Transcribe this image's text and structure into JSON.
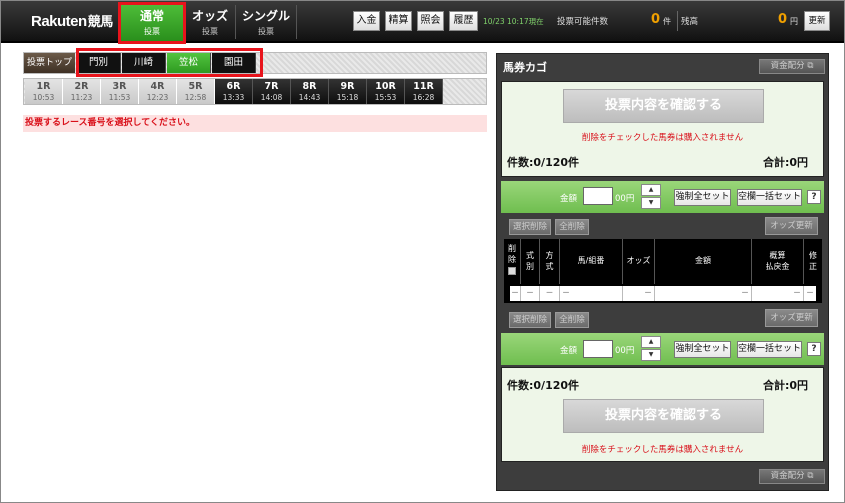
{
  "header": {
    "logo": "Rakuten",
    "logo_sub": "競馬",
    "tabs": [
      {
        "title": "通常",
        "sub": "投票",
        "active": true
      },
      {
        "title": "オッズ",
        "sub": "投票",
        "active": false
      },
      {
        "title": "シングル",
        "sub": "投票",
        "active": false
      }
    ],
    "buttons": {
      "deposit": "入金",
      "settle": "精算",
      "inquiry": "照会",
      "history": "履歴",
      "refresh": "更新"
    },
    "as_of": "10/23 10:17現在",
    "votable_label": "投票可能件数",
    "votable_value": "0",
    "votable_unit": "件",
    "balance_label": "残高",
    "balance_value": "0",
    "balance_unit": "円"
  },
  "tracks": {
    "top_label": "投票トップ",
    "items": [
      {
        "name": "門別",
        "active": false
      },
      {
        "name": "川崎",
        "active": false
      },
      {
        "name": "笠松",
        "active": true
      },
      {
        "name": "園田",
        "active": false
      }
    ]
  },
  "races": [
    {
      "num": "1R",
      "time": "10:53",
      "open": false
    },
    {
      "num": "2R",
      "time": "11:23",
      "open": false
    },
    {
      "num": "3R",
      "time": "11:53",
      "open": false
    },
    {
      "num": "4R",
      "time": "12:23",
      "open": false
    },
    {
      "num": "5R",
      "time": "12:58",
      "open": false
    },
    {
      "num": "6R",
      "time": "13:33",
      "open": true
    },
    {
      "num": "7R",
      "time": "14:08",
      "open": true
    },
    {
      "num": "8R",
      "time": "14:43",
      "open": true
    },
    {
      "num": "9R",
      "time": "15:18",
      "open": true
    },
    {
      "num": "10R",
      "time": "15:53",
      "open": true
    },
    {
      "num": "11R",
      "time": "16:28",
      "open": true
    }
  ],
  "message": "投票するレース番号を選択してください。",
  "cart": {
    "title": "馬券カゴ",
    "fund_button": "資金配分",
    "confirm_button": "投票内容を確認する",
    "warning": "削除をチェックした馬券は購入されません",
    "count_label": "件数:0/120件",
    "total_label": "合計:0円",
    "amount_label": "金額",
    "amount_unit": "00円",
    "force_set": "強制全セット",
    "blank_set": "空欄一括セット",
    "help": "?",
    "delete_selected": "選択削除",
    "delete_all": "全削除",
    "odds_refresh": "オッズ更新",
    "columns": {
      "del": "削除",
      "shiki": "式別",
      "hoshiki": "方式",
      "horse": "馬/組番",
      "odds": "オッズ",
      "amount": "金額",
      "payout1": "概算",
      "payout2": "払戻金",
      "edit": "修正"
    },
    "row": {
      "c1": "－",
      "c2": "－",
      "c3": "－",
      "c4": "－",
      "c5": "－",
      "c6": "－",
      "c7": "－",
      "c8": "－"
    }
  }
}
